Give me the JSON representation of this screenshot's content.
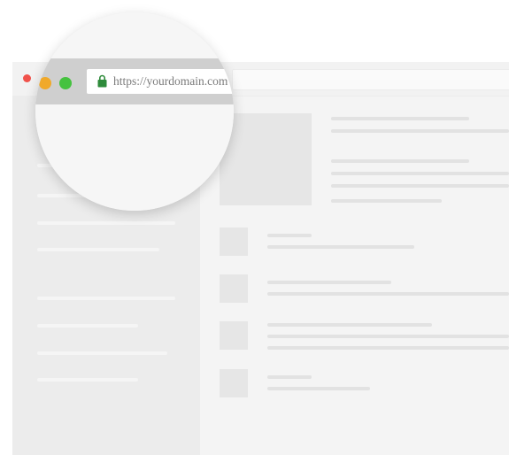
{
  "browser": {
    "url": "https://yourdomain.com",
    "traffic_lights": {
      "close": "#f0524b",
      "minimize": "#f0a92a",
      "maximize": "#45c23f"
    },
    "lock_color": "#2e8b3b"
  }
}
